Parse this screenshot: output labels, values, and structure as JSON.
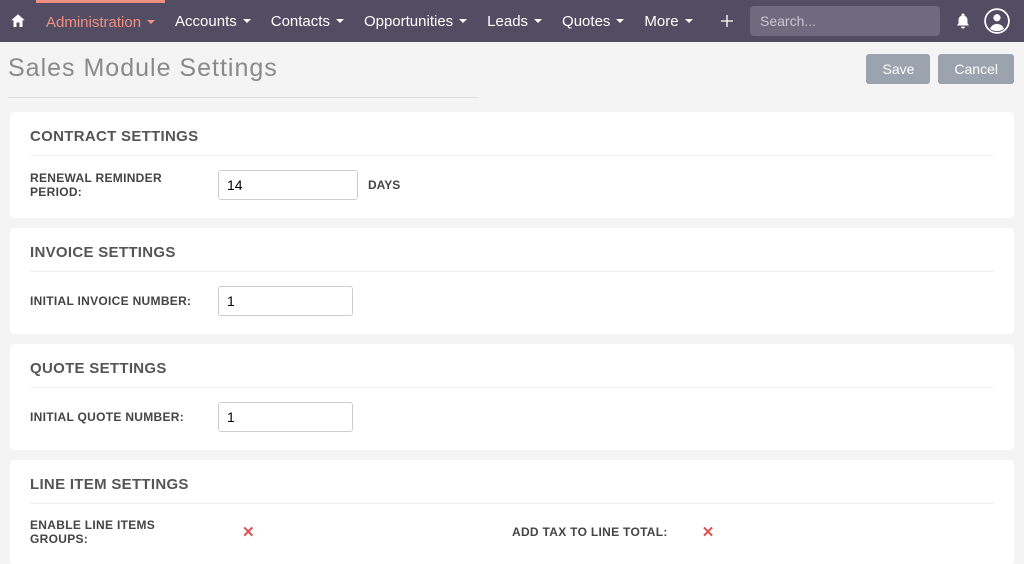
{
  "nav": {
    "items": [
      {
        "label": "Administration",
        "active": true
      },
      {
        "label": "Accounts",
        "active": false
      },
      {
        "label": "Contacts",
        "active": false
      },
      {
        "label": "Opportunities",
        "active": false
      },
      {
        "label": "Leads",
        "active": false
      },
      {
        "label": "Quotes",
        "active": false
      },
      {
        "label": "More",
        "active": false
      }
    ],
    "search_placeholder": "Search..."
  },
  "page": {
    "title": "Sales Module Settings",
    "save_label": "Save",
    "cancel_label": "Cancel"
  },
  "contract": {
    "heading": "CONTRACT SETTINGS",
    "reminder_label": "RENEWAL REMINDER PERIOD:",
    "reminder_value": "14",
    "reminder_unit": "DAYS"
  },
  "invoice": {
    "heading": "INVOICE SETTINGS",
    "initial_label": "INITIAL INVOICE NUMBER:",
    "initial_value": "1"
  },
  "quote": {
    "heading": "QUOTE SETTINGS",
    "initial_label": "INITIAL QUOTE NUMBER:",
    "initial_value": "1"
  },
  "lineitem": {
    "heading": "LINE ITEM SETTINGS",
    "groups_label": "ENABLE LINE ITEMS GROUPS:",
    "groups_value": false,
    "tax_label": "ADD TAX TO LINE TOTAL:",
    "tax_value": false
  }
}
